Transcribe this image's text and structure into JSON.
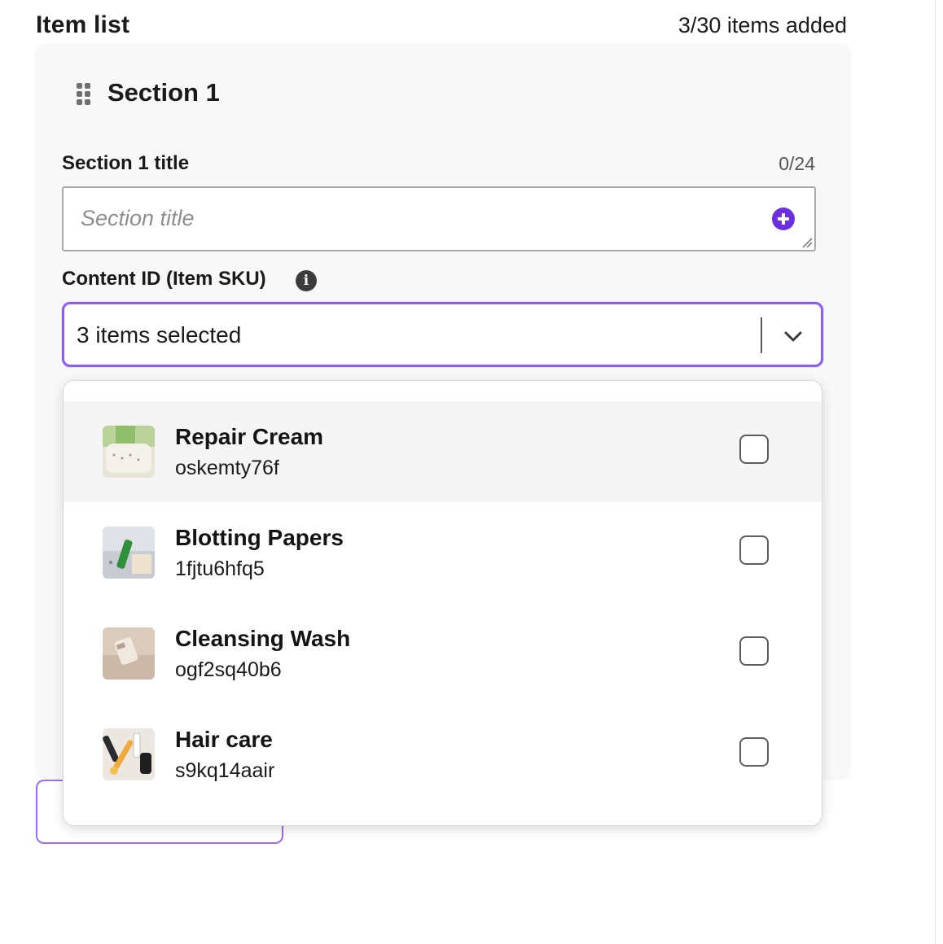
{
  "header": {
    "title": "Item list",
    "count": "3/30 items added"
  },
  "section": {
    "heading": "Section 1",
    "title_field": {
      "label": "Section 1 title",
      "char_count": "0/24",
      "placeholder": "Section title",
      "value": ""
    },
    "content_id": {
      "label": "Content ID (Item SKU)",
      "selected_text": "3 items selected"
    }
  },
  "colors": {
    "accent": "#6b2ee0",
    "focus_border": "#8b5cf6",
    "highlight_row": "#f5f5f5"
  },
  "icons": {
    "drag": "drag-handle-icon",
    "add": "plus-circle-icon",
    "info": "info-icon",
    "chevron": "chevron-down-icon",
    "resize": "resize-handle-icon"
  },
  "dropdown": {
    "options": [
      {
        "name": "Repair Cream",
        "sku": "oskemty76f",
        "checked": false,
        "highlighted": true
      },
      {
        "name": "Blotting Papers",
        "sku": "1fjtu6hfq5",
        "checked": false,
        "highlighted": false
      },
      {
        "name": "Cleansing Wash",
        "sku": "ogf2sq40b6",
        "checked": false,
        "highlighted": false
      },
      {
        "name": "Hair care",
        "sku": "s9kq14aair",
        "checked": false,
        "highlighted": false
      }
    ]
  }
}
